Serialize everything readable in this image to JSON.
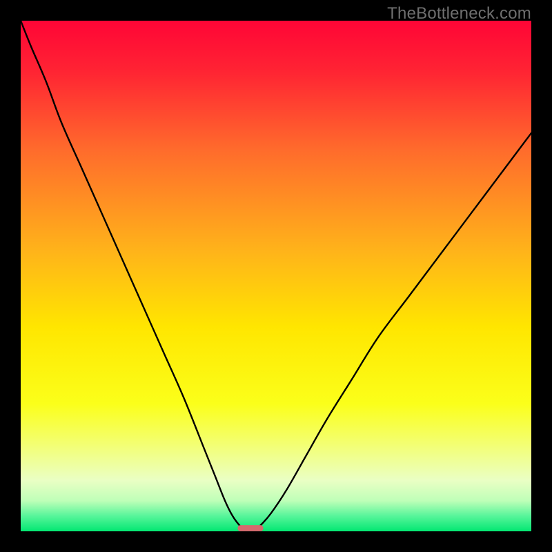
{
  "watermark": "TheBottleneck.com",
  "chart_data": {
    "type": "line",
    "title": "",
    "xlabel": "",
    "ylabel": "",
    "xlim": [
      0,
      100
    ],
    "ylim": [
      0,
      100
    ],
    "gradient_stops": [
      {
        "offset": 0.0,
        "color": "#ff0536"
      },
      {
        "offset": 0.1,
        "color": "#ff2433"
      },
      {
        "offset": 0.25,
        "color": "#ff6a2c"
      },
      {
        "offset": 0.45,
        "color": "#ffb31a"
      },
      {
        "offset": 0.6,
        "color": "#ffe600"
      },
      {
        "offset": 0.75,
        "color": "#fbff1a"
      },
      {
        "offset": 0.83,
        "color": "#f3ff73"
      },
      {
        "offset": 0.9,
        "color": "#eaffc4"
      },
      {
        "offset": 0.94,
        "color": "#bfffb8"
      },
      {
        "offset": 0.97,
        "color": "#57f59a"
      },
      {
        "offset": 1.0,
        "color": "#03e772"
      }
    ],
    "curve": {
      "x": [
        0,
        2,
        5,
        8,
        12,
        16,
        20,
        24,
        28,
        32,
        36,
        38,
        40,
        41.5,
        43,
        44,
        45,
        46,
        47,
        49,
        52,
        56,
        60,
        65,
        70,
        76,
        82,
        88,
        94,
        100
      ],
      "y": [
        100,
        95,
        88,
        80,
        71,
        62,
        53,
        44,
        35,
        26,
        16,
        11,
        6,
        3,
        1,
        0.3,
        0,
        0.3,
        1.2,
        3.5,
        8,
        15,
        22,
        30,
        38,
        46,
        54,
        62,
        70,
        78
      ]
    },
    "marker": {
      "x": 45,
      "width": 5,
      "height": 1.2,
      "color": "#d46a6e"
    }
  }
}
